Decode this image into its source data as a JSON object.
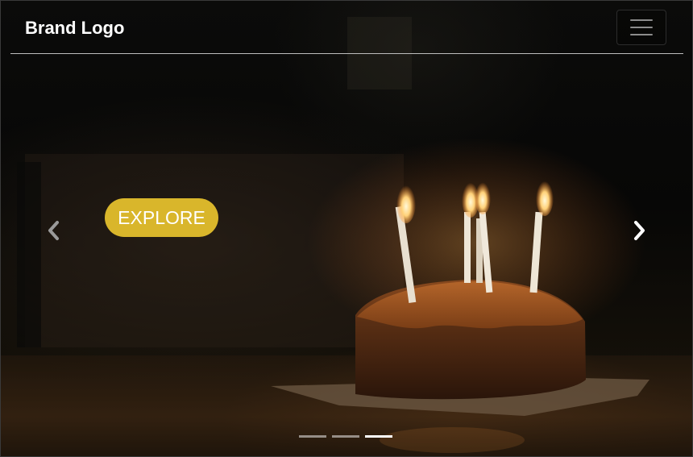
{
  "navbar": {
    "brand": "Brand Logo",
    "menu_icon": "hamburger-menu-icon"
  },
  "hero": {
    "cta_label": "EXPLORE",
    "cta_color": "#d9b62b",
    "prev_icon": "chevron-left-icon",
    "next_icon": "chevron-right-icon",
    "image": "birthday-cake-with-candles"
  },
  "carousel": {
    "slide_count": 3,
    "active_index": 3
  }
}
